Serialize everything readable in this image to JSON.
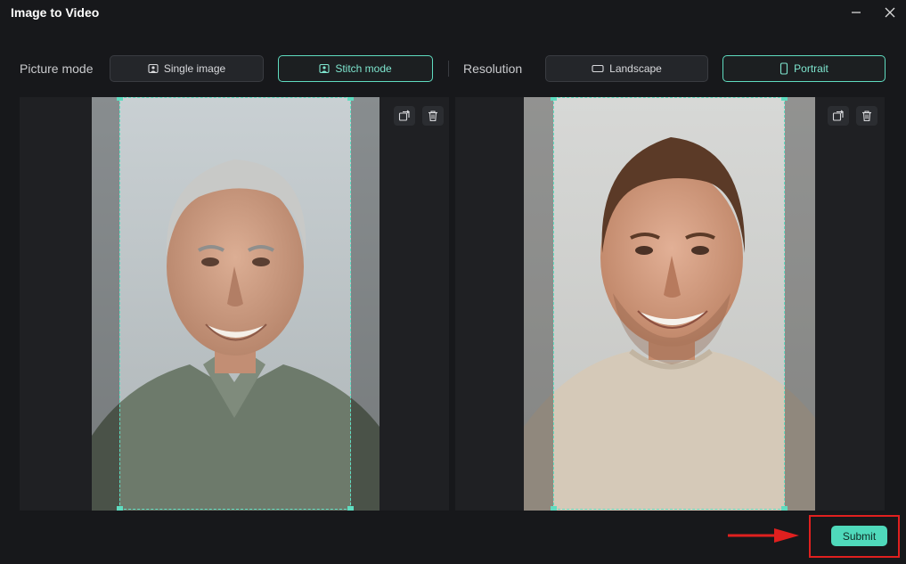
{
  "window": {
    "title": "Image to Video"
  },
  "picture_mode": {
    "label": "Picture mode",
    "options": [
      {
        "label": "Single image",
        "selected": false
      },
      {
        "label": "Stitch mode",
        "selected": true
      }
    ]
  },
  "resolution": {
    "label": "Resolution",
    "options": [
      {
        "label": "Landscape",
        "selected": false
      },
      {
        "label": "Portrait",
        "selected": true
      }
    ]
  },
  "images": [
    {
      "subject": "older-man-portrait",
      "tools": [
        "replace-icon",
        "trash-icon"
      ]
    },
    {
      "subject": "younger-man-portrait",
      "tools": [
        "replace-icon",
        "trash-icon"
      ]
    }
  ],
  "footer": {
    "submit_label": "Submit"
  },
  "colors": {
    "accent": "#5fdcc0",
    "submit_bg": "#4fd9bb",
    "highlight": "#e0201f",
    "background": "#17181b"
  }
}
